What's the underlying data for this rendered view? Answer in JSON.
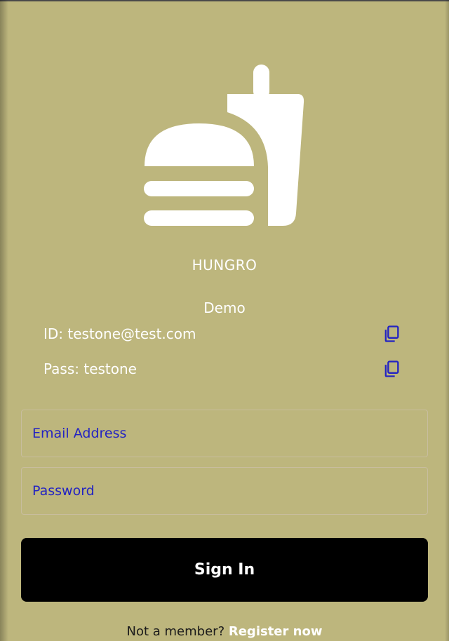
{
  "app": {
    "name": "HUNGRO",
    "logo_icon": "burger-and-drink-icon"
  },
  "colors": {
    "background": "#BDB67D",
    "accent": "#2323C2",
    "button": "#000000",
    "text_light": "#FFFFFF"
  },
  "demo": {
    "title": "Demo",
    "id_label": "ID: testone@test.com",
    "pass_label": "Pass: testone",
    "copy_icon": "copy-icon"
  },
  "form": {
    "email_placeholder": "Email Address",
    "password_placeholder": "Password",
    "submit_label": "Sign In"
  },
  "footer": {
    "prompt": "Not a member?",
    "link": "Register now"
  }
}
